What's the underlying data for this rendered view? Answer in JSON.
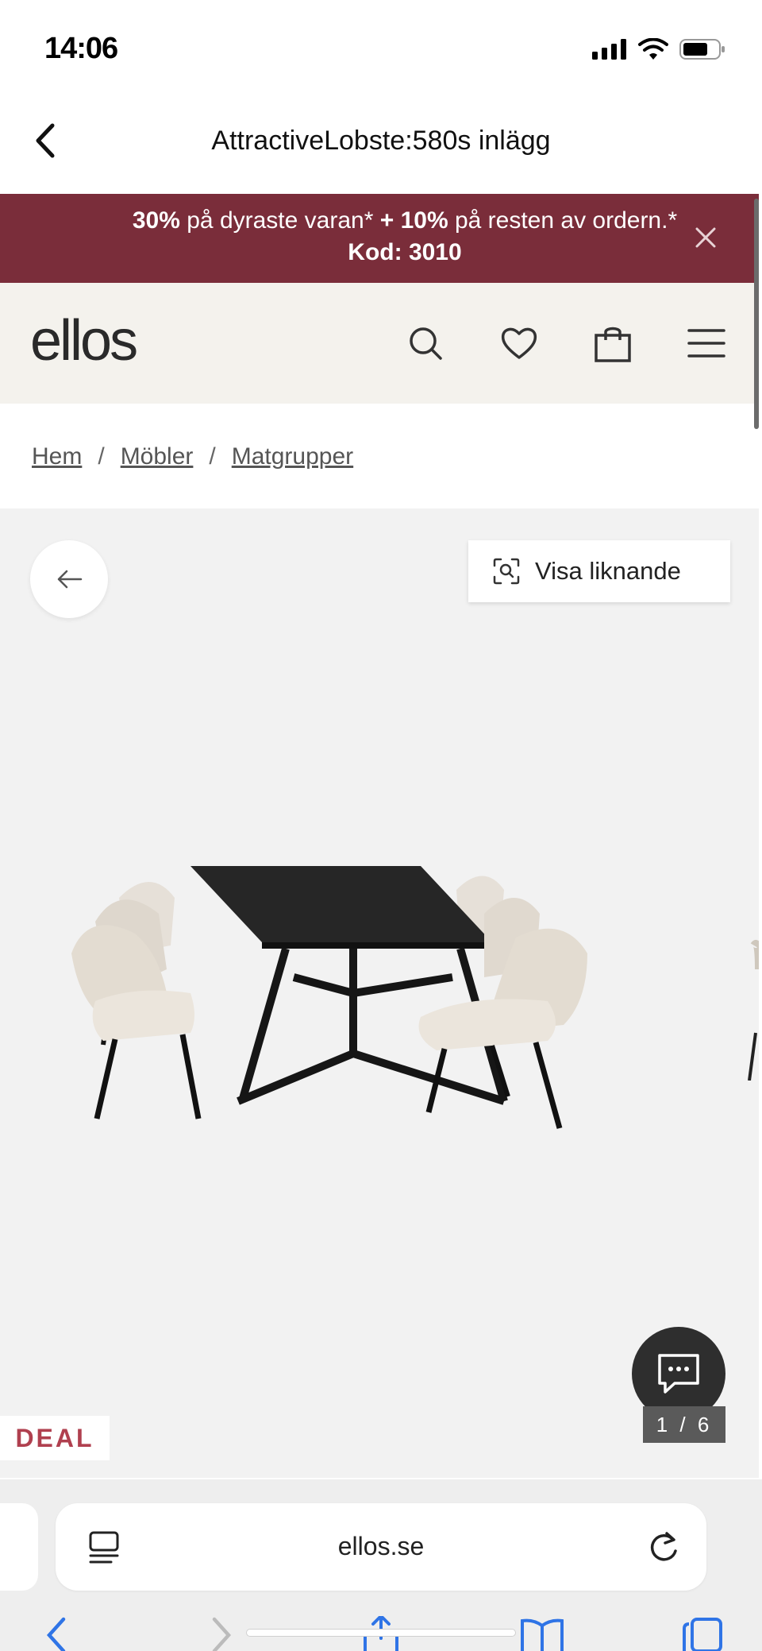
{
  "status_bar": {
    "time": "14:06"
  },
  "title_bar": {
    "title": "AttractiveLobste:580s inlägg"
  },
  "promo": {
    "part1_bold": "30%",
    "part1_text": " på dyraste varan* ",
    "part2_bold": "+ 10%",
    "part2_text": " på resten av ordern.* ",
    "code_bold": "Kod: 3010",
    "accent_color": "#7a2d3a"
  },
  "header": {
    "logo": "ellos",
    "icons": [
      "search-icon",
      "heart-icon",
      "bag-icon",
      "menu-icon"
    ]
  },
  "breadcrumb": {
    "items": [
      "Hem",
      "Möbler",
      "Matgrupper"
    ],
    "separator": "/"
  },
  "gallery": {
    "similar_label": "Visa liknande",
    "pager": "1 / 6",
    "deal_badge": "DEAL"
  },
  "browser": {
    "url": "ellos.se"
  }
}
